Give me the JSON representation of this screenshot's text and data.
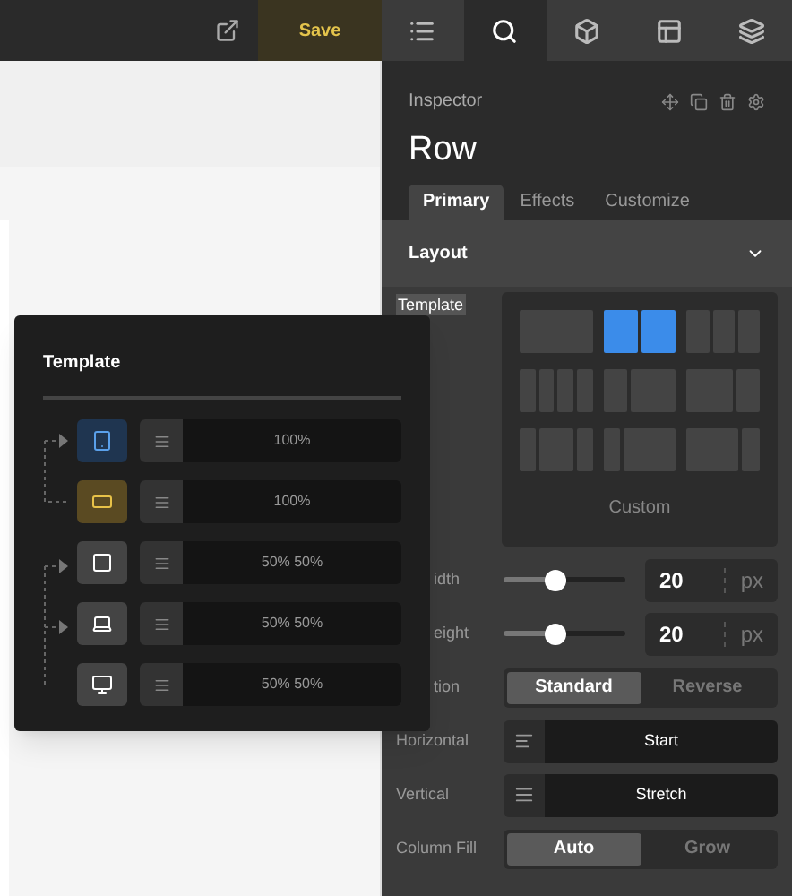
{
  "toolbar": {
    "save": "Save",
    "tabs": [
      {
        "kind": "list",
        "selected": false
      },
      {
        "kind": "search",
        "selected": true
      },
      {
        "kind": "cube",
        "selected": false
      },
      {
        "kind": "layout",
        "selected": false
      },
      {
        "kind": "layers",
        "selected": false
      }
    ]
  },
  "inspector": {
    "label": "Inspector",
    "title": "Row",
    "tabs": [
      {
        "label": "Primary",
        "selected": true
      },
      {
        "label": "Effects",
        "selected": false
      },
      {
        "label": "Customize",
        "selected": false
      }
    ],
    "section": {
      "title": "Layout",
      "expanded": true,
      "template_label": "Template",
      "template_options": [
        {
          "selected": false
        },
        {
          "selected": true
        },
        {
          "selected": false
        },
        {
          "selected": false
        },
        {
          "selected": false
        },
        {
          "selected": false
        },
        {
          "selected": false
        },
        {
          "selected": false
        },
        {
          "selected": false
        }
      ],
      "custom": "Custom",
      "rows": [
        {
          "kind": "slider",
          "label": "idth",
          "level": 0.42,
          "value": "20",
          "unit": "px"
        },
        {
          "kind": "slider",
          "label": "eight",
          "level": 0.42,
          "value": "20",
          "unit": "px"
        },
        {
          "kind": "toggle",
          "label": "tion",
          "options": [
            {
              "label": "Standard",
              "selected": true
            },
            {
              "label": "Reverse",
              "selected": false
            }
          ]
        },
        {
          "kind": "select",
          "label": "Horizontal",
          "value": "Start"
        },
        {
          "kind": "select",
          "label": "Vertical",
          "value": "Stretch"
        },
        {
          "kind": "toggle",
          "label": "Column Fill",
          "options": [
            {
              "label": "Auto",
              "selected": true
            },
            {
              "label": "Grow",
              "selected": false
            }
          ]
        }
      ]
    }
  },
  "template_popup": {
    "title": "Template",
    "rows": [
      {
        "kind": "tablet",
        "value": "100%"
      },
      {
        "kind": "landscape",
        "value": "100%"
      },
      {
        "kind": "square",
        "value": "50% 50%"
      },
      {
        "kind": "laptop",
        "value": "50% 50%"
      },
      {
        "kind": "desktop",
        "value": "50% 50%"
      }
    ]
  }
}
